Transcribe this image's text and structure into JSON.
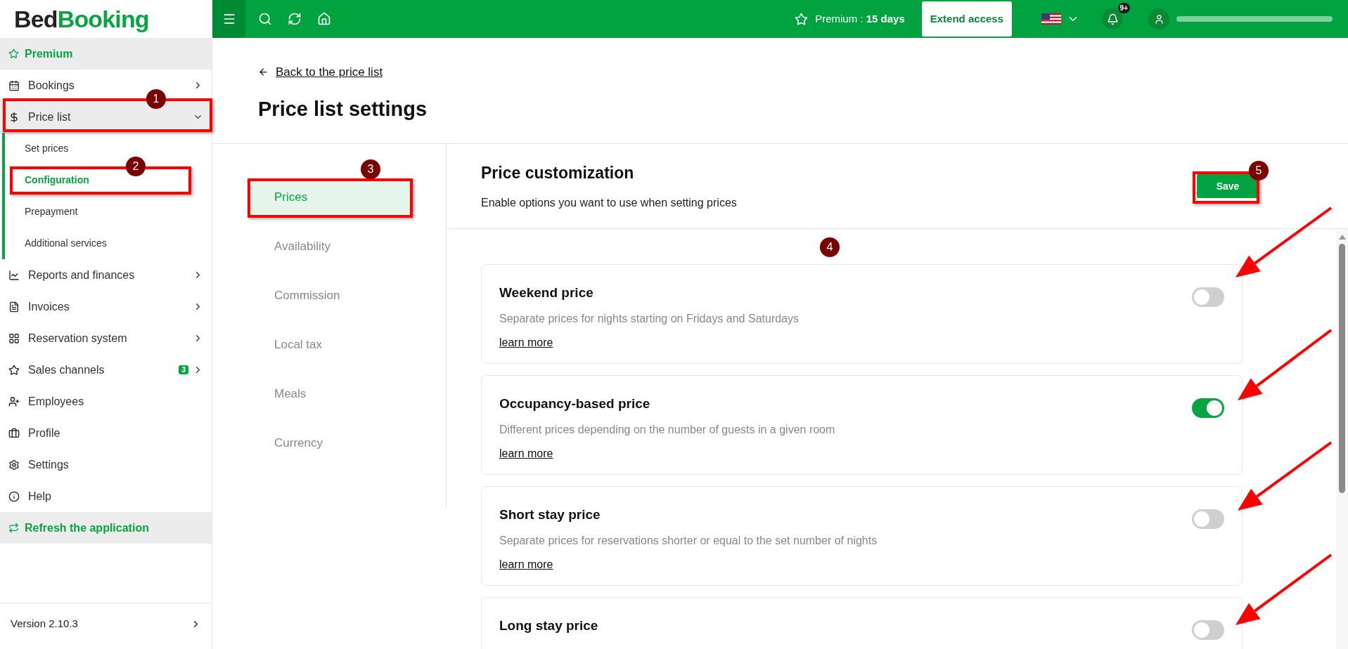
{
  "logo": {
    "part1": "Bed",
    "part2": "Booking"
  },
  "topbar": {
    "premium_label": "Premium : ",
    "premium_days": "15 days",
    "extend_button": "Extend access",
    "notifications_badge": "9+"
  },
  "sidebar": {
    "premium": "Premium",
    "items": [
      {
        "label": "Bookings",
        "kind": "group",
        "expanded": false
      },
      {
        "label": "Price list",
        "kind": "group",
        "expanded": true,
        "children": [
          {
            "label": "Set prices",
            "selected": false
          },
          {
            "label": "Configuration",
            "selected": true
          },
          {
            "label": "Prepayment",
            "selected": false
          },
          {
            "label": "Additional services",
            "selected": false
          }
        ]
      },
      {
        "label": "Reports and finances",
        "kind": "group",
        "expanded": false
      },
      {
        "label": "Invoices",
        "kind": "group",
        "expanded": false
      },
      {
        "label": "Reservation system",
        "kind": "group",
        "expanded": false
      },
      {
        "label": "Sales channels",
        "kind": "group",
        "expanded": false,
        "badge": "3"
      },
      {
        "label": "Employees",
        "kind": "link"
      },
      {
        "label": "Profile",
        "kind": "link"
      },
      {
        "label": "Settings",
        "kind": "link"
      },
      {
        "label": "Help",
        "kind": "link"
      }
    ],
    "refresh": "Refresh the application",
    "version": "Version 2.10.3"
  },
  "back_link": "Back to the price list",
  "title": "Price list settings",
  "tabs": [
    {
      "label": "Prices",
      "selected": true
    },
    {
      "label": "Availability",
      "selected": false
    },
    {
      "label": "Commission",
      "selected": false
    },
    {
      "label": "Local tax",
      "selected": false
    },
    {
      "label": "Meals",
      "selected": false
    },
    {
      "label": "Currency",
      "selected": false
    }
  ],
  "section": {
    "title": "Price customization",
    "subtitle": "Enable options you want to use when setting prices",
    "save_button": "Save",
    "options": [
      {
        "title": "Weekend price",
        "description": "Separate prices for nights starting on Fridays and Saturdays",
        "link": "learn more",
        "on": false
      },
      {
        "title": "Occupancy-based price",
        "description": "Different prices depending on the number of guests in a given room",
        "link": "learn more",
        "on": true
      },
      {
        "title": "Short stay price",
        "description": "Separate prices for reservations shorter or equal to the set number of nights",
        "link": "learn more",
        "on": false
      },
      {
        "title": "Long stay price",
        "on": false
      }
    ]
  },
  "annotations": [
    {
      "label": "1",
      "boxed": true
    },
    {
      "label": "2",
      "boxed": true
    },
    {
      "label": "3",
      "boxed": true
    },
    {
      "label": "4",
      "boxed": false
    },
    {
      "label": "5",
      "boxed": true
    }
  ]
}
